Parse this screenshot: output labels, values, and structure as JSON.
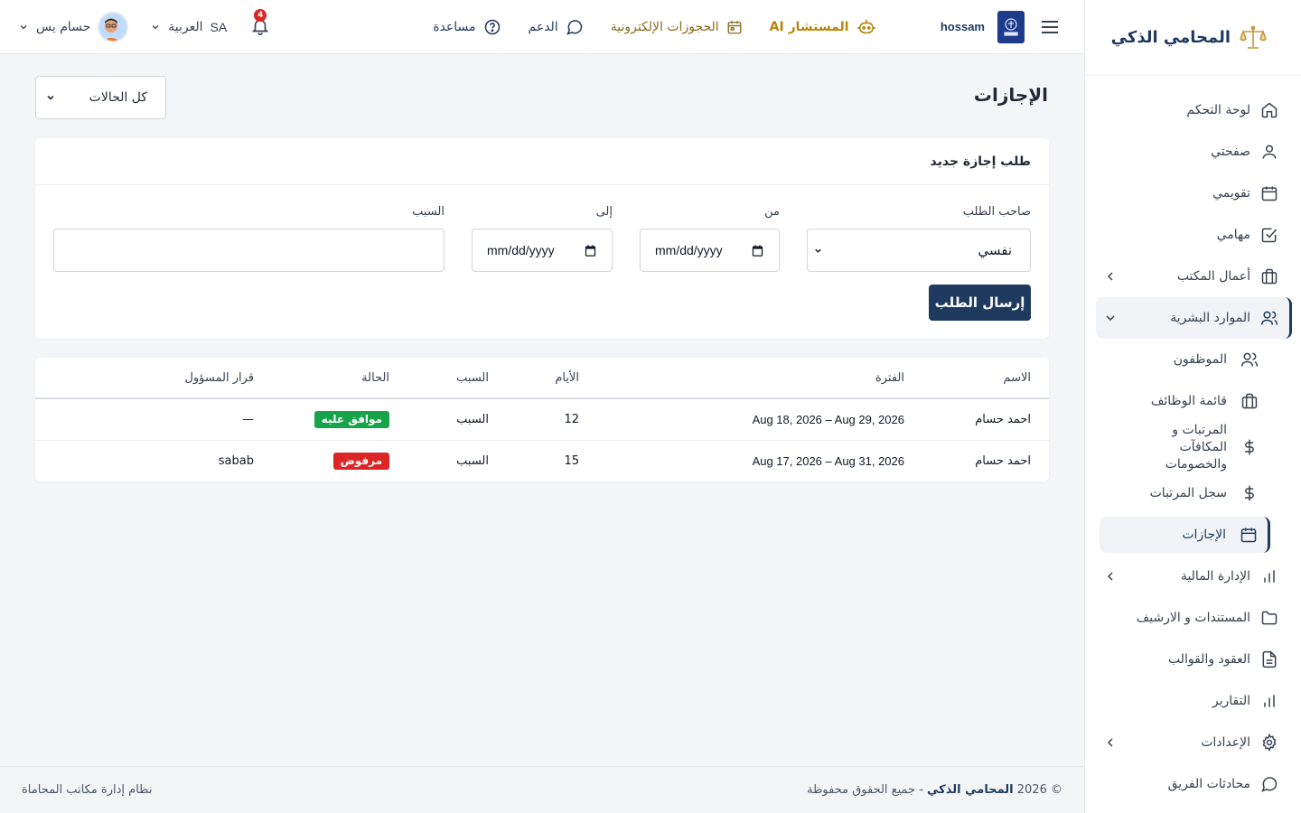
{
  "colors": {
    "primary": "#1e3a5f",
    "gold": "#b8860b",
    "approved": "#16a34a",
    "rejected": "#dc2626",
    "badge": "#dc2626"
  },
  "brand": {
    "title": "المحامي الذكي",
    "icon": "scales-icon"
  },
  "sidebar": {
    "items": [
      {
        "key": "dashboard",
        "label": "لوحة التحكم",
        "icon": "home-icon"
      },
      {
        "key": "profile",
        "label": "صفحتي",
        "icon": "user-icon"
      },
      {
        "key": "calendar",
        "label": "تقويمي",
        "icon": "calendar-icon"
      },
      {
        "key": "tasks",
        "label": "مهامي",
        "icon": "checkbox-icon"
      },
      {
        "key": "office",
        "label": "أعمال المكتب",
        "icon": "briefcase-icon"
      },
      {
        "key": "hr",
        "label": "الموارد البشرية",
        "icon": "users-icon"
      },
      {
        "key": "finance",
        "label": "الإدارة المالية",
        "icon": "bar-chart-icon"
      },
      {
        "key": "documents",
        "label": "المستندات و الارشيف",
        "icon": "folder-icon"
      },
      {
        "key": "contracts",
        "label": "العقود والقوالب",
        "icon": "file-text-icon"
      },
      {
        "key": "reports",
        "label": "التقارير",
        "icon": "bar-chart-icon"
      },
      {
        "key": "settings",
        "label": "الإعدادات",
        "icon": "gear-icon"
      },
      {
        "key": "team_chat",
        "label": "محادثات الفريق",
        "icon": "chat-icon"
      }
    ],
    "hr_sub": [
      {
        "key": "employees",
        "label": "الموظفون",
        "icon": "users-icon"
      },
      {
        "key": "jobs",
        "label": "قائمة الوظائف",
        "icon": "briefcase-icon"
      },
      {
        "key": "salaries",
        "label": "المرتبات و المكافآت والخصومات",
        "icon": "dollar-icon"
      },
      {
        "key": "payroll",
        "label": "سجل المرتبات",
        "icon": "dollar-icon"
      },
      {
        "key": "leaves",
        "label": "الإجازات",
        "icon": "calendar-icon"
      }
    ]
  },
  "header": {
    "org_name": "hossam",
    "links": {
      "ai": "المستشار AI",
      "bookings": "الحجوزات الإلكترونية",
      "support": "الدعم",
      "help": "مساعدة"
    },
    "notifications_count": "4",
    "language": "العربية",
    "language_code": "SA",
    "user_name": "حسام يس"
  },
  "page": {
    "title": "الإجازات",
    "filter": {
      "selected": "كل الحالات"
    }
  },
  "form": {
    "title": "طلب إجازة جديد",
    "requester_label": "صاحب الطلب",
    "requester_value": "نفسي",
    "from_label": "من",
    "from_placeholder": "mm/dd/yyyy",
    "to_label": "إلى",
    "to_placeholder": "mm/dd/yyyy",
    "reason_label": "السبب",
    "reason_value": "",
    "submit_label": "إرسال الطلب"
  },
  "table": {
    "headers": {
      "name": "الاسم",
      "period": "الفترة",
      "days": "الأيام",
      "reason": "السبب",
      "status": "الحالة",
      "decision": "قرار المسؤول"
    },
    "rows": [
      {
        "name": "احمد حسام",
        "period": "Aug 18, 2026 – Aug 29, 2026",
        "days": "12",
        "reason": "السبب",
        "status": "موافق عليه",
        "status_type": "approved",
        "decision": "—"
      },
      {
        "name": "احمد حسام",
        "period": "Aug 17, 2026 – Aug 31, 2026",
        "days": "15",
        "reason": "السبب",
        "status": "مرفوض",
        "status_type": "rejected",
        "decision": "sabab"
      }
    ]
  },
  "footer": {
    "copyright_prefix": "© 2026",
    "copyright_brand": "المحامي الذكي",
    "copyright_suffix": "- جميع الحقوق محفوظة",
    "tagline": "نظام إدارة مكاتب المحاماة"
  }
}
